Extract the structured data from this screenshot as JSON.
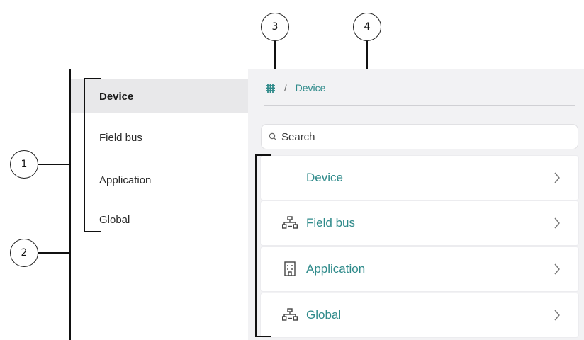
{
  "callouts": {
    "c1": "1",
    "c2": "2",
    "c3": "3",
    "c4": "4"
  },
  "sidebar": {
    "items": [
      {
        "label": "Device",
        "active": true
      },
      {
        "label": "Field bus",
        "active": false
      },
      {
        "label": "Application",
        "active": false
      },
      {
        "label": "Global",
        "active": false
      }
    ]
  },
  "breadcrumb": {
    "separator": "/",
    "current": "Device",
    "home_icon": "grid-icon"
  },
  "search": {
    "placeholder": "Search",
    "value": ""
  },
  "cards": [
    {
      "label": "Device",
      "icon": ""
    },
    {
      "label": "Field bus",
      "icon": "network-icon"
    },
    {
      "label": "Application",
      "icon": "building-icon"
    },
    {
      "label": "Global",
      "icon": "network-icon"
    }
  ],
  "colors": {
    "accent": "#2e8a8a",
    "sidebar_active_bg": "#e8e8ea",
    "main_bg": "#f2f2f4"
  }
}
